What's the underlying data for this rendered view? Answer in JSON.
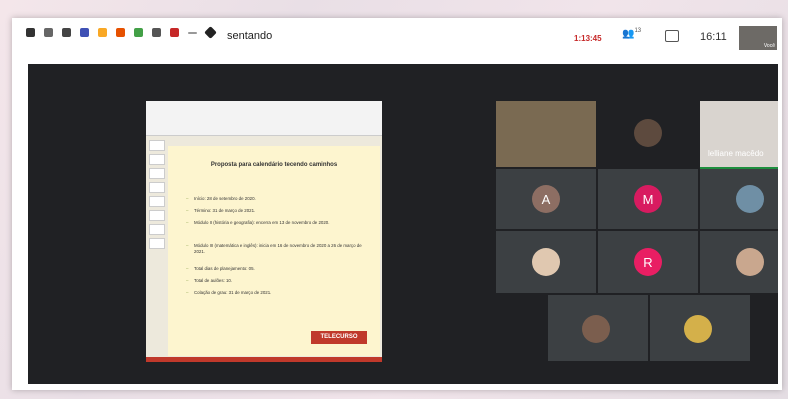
{
  "topbar": {
    "presenting": "sentando",
    "timer": "1:13:45",
    "people_count": "13",
    "clock": "16:11",
    "self_label": "Você"
  },
  "slide": {
    "title": "Proposta para calendário tecendo caminhos",
    "bullets": [
      "Início: 28 de setembro de 2020.",
      "Término: 31 de março de 2021.",
      "Módulo II (história e geografia): encerra em 13 de novembro de 2020.",
      "Módulo III (matemática e inglês): inicia em 16 de novembro de 2020 a 26 de março de 2021.",
      "Total dias de planejamento: 05.",
      "Total de aulões: 10.",
      "Colação de grau: 31 de março de 2021."
    ],
    "logo": "TELECURSO"
  },
  "participants": {
    "initials": [
      "A",
      "M",
      "R"
    ],
    "name": "lelliane macêdo"
  },
  "colors": {
    "meet_bg": "#202124",
    "tile": "#3c4043",
    "avatar_a": "#8d6e63",
    "avatar_m": "#d81b60",
    "avatar_r": "#e91e63",
    "accent": "#1e8e3e"
  }
}
